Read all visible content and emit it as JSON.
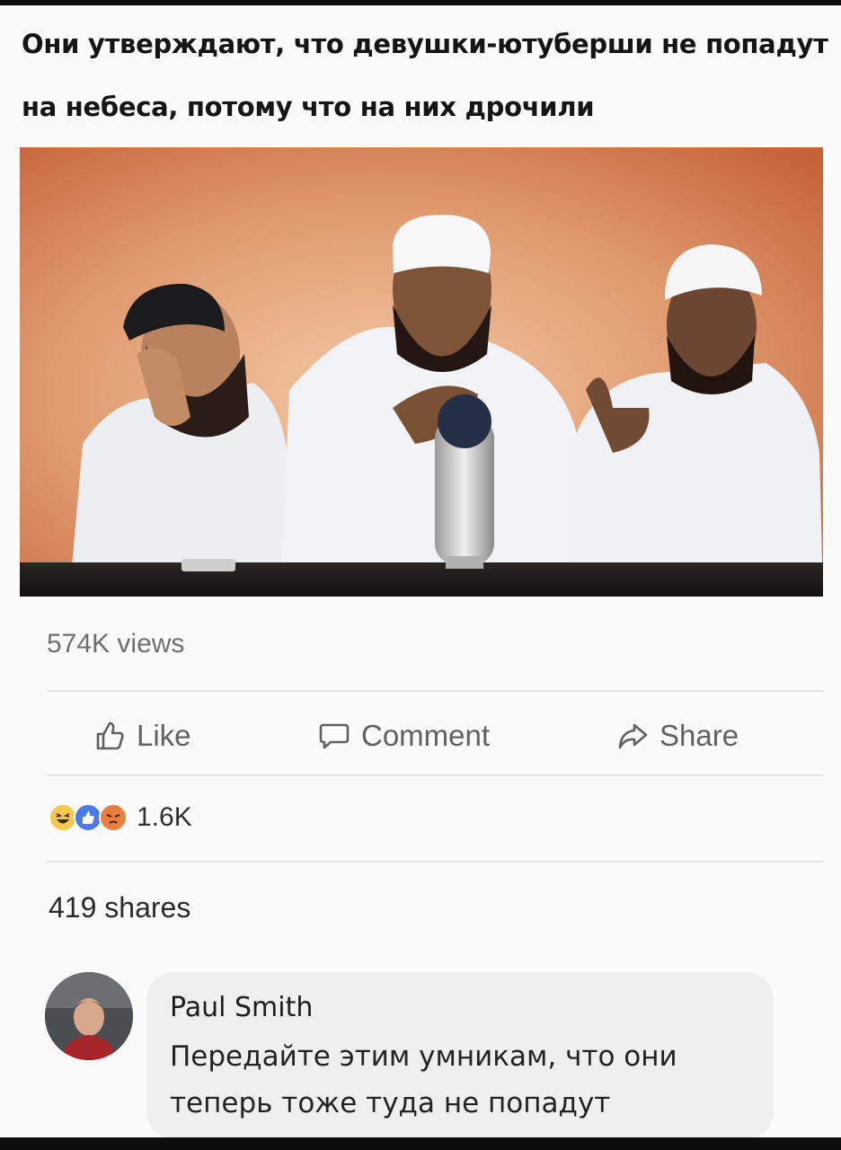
{
  "caption": "Они утверждают, что девушки-ютуберши не попадут на небеса, потому что на них дрочили",
  "post": {
    "views": "574K views",
    "actions": {
      "like": "Like",
      "comment": "Comment",
      "share": "Share"
    },
    "reaction_count": "1.6K",
    "shares": "419 shares"
  },
  "icons": {
    "like": "thumbs-up-icon",
    "comment": "speech-bubble-icon",
    "share": "share-arrow-icon",
    "reactions": [
      "haha-reaction-icon",
      "like-reaction-icon",
      "angry-reaction-icon"
    ]
  },
  "comment": {
    "author": "Paul Smith",
    "text": "Передайте этим умникам, что они теперь тоже туда не попадут"
  },
  "colors": {
    "like_blue": "#4a79e8",
    "haha_yellow": "#f5c84a",
    "angry_orange": "#ea8040",
    "meta_gray": "#6f6f6f"
  }
}
